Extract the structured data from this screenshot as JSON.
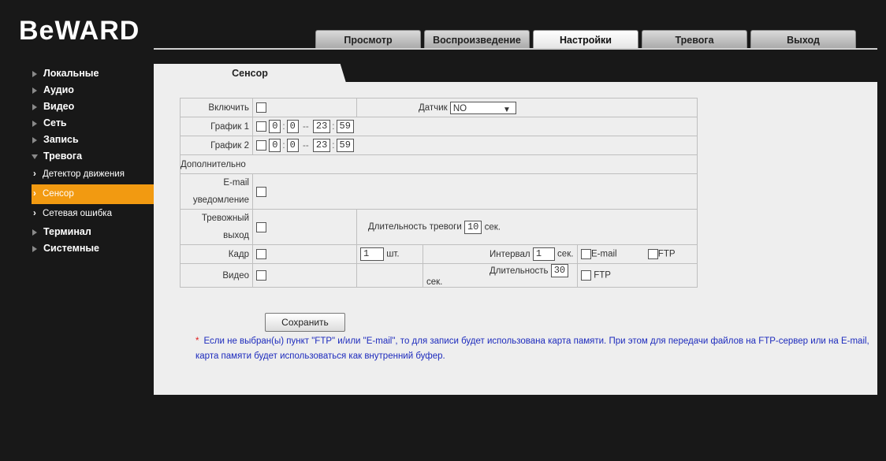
{
  "logo": {
    "text": "BeWARD"
  },
  "top_nav": [
    {
      "label": "Просмотр"
    },
    {
      "label": "Воспроизведение"
    },
    {
      "label": "Настройки"
    },
    {
      "label": "Тревога"
    },
    {
      "label": "Выход"
    }
  ],
  "sidebar": {
    "items": [
      {
        "label": "Локальные"
      },
      {
        "label": "Аудио"
      },
      {
        "label": "Видео"
      },
      {
        "label": "Сеть"
      },
      {
        "label": "Запись"
      },
      {
        "label": "Тревога"
      },
      {
        "label": "Терминал"
      },
      {
        "label": "Системные"
      }
    ],
    "sub_items": [
      {
        "label": "Детектор движения"
      },
      {
        "label": "Сенсор"
      },
      {
        "label": "Сетевая ошибка"
      }
    ]
  },
  "subtab": {
    "label": "Сенсор"
  },
  "form": {
    "enable_label": "Включить",
    "sensor_label": "Датчик",
    "sensor_value": "NO",
    "schedule1_label": "График 1",
    "schedule2_label": "График 2",
    "schedule1": {
      "h1": "0",
      "m1": "0",
      "h2": "23",
      "m2": "59"
    },
    "schedule2": {
      "h1": "0",
      "m1": "0",
      "h2": "23",
      "m2": "59"
    },
    "range_sep": "--",
    "time_sep": ":",
    "extra_label": "Дополнительно",
    "email_label": "E-mail уведомление",
    "alarm_out_label": "Тревожный выход",
    "alarm_duration_label": "Длительность тревоги",
    "alarm_duration_value": "10",
    "sec": "сек.",
    "frame_label": "Кадр",
    "frame_count": "1",
    "pcs": "шт.",
    "interval_label": "Интервал",
    "interval_value": "1",
    "email_opt": "E-mail",
    "ftp_opt": "FTP",
    "video_label": "Видео",
    "duration_label": "Длительность",
    "duration_value": "30"
  },
  "save_label": "Сохранить",
  "note": {
    "star": "*",
    "text": "Если не выбран(ы) пункт \"FTP\" и/или \"E-mail\", то для записи будет использована карта памяти. При этом для передачи файлов на FTP-сервер или на E-mail, карта памяти будет использоваться как внутренний буфер."
  }
}
